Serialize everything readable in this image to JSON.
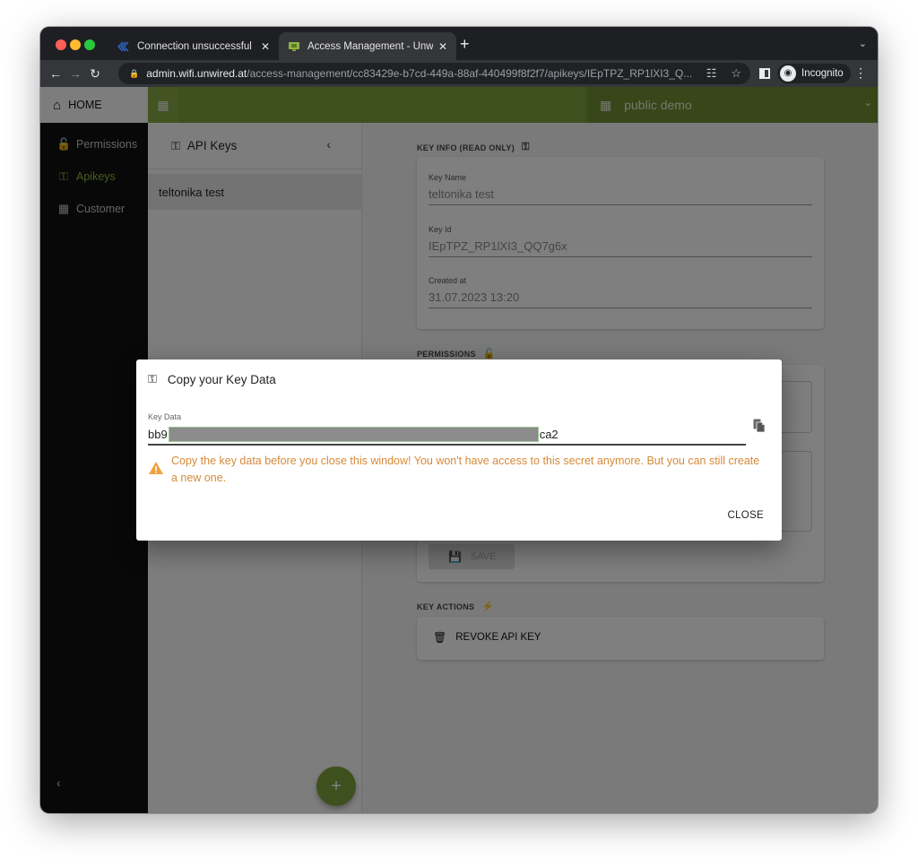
{
  "browser": {
    "tabs": [
      {
        "title": "Connection unsuccessful",
        "active": false,
        "favicon": "unwired-logo-icon"
      },
      {
        "title": "Access Management - Unwired",
        "active": true,
        "favicon": "monitor-icon"
      }
    ],
    "new_tab_label": "+",
    "address": {
      "host": "admin.wifi.unwired.at",
      "path": "/access-management/cc83429e-b7cd-449a-88af-440499f8f2f7/apikeys/IEpTPZ_RP1lXI3_Q..."
    },
    "profile_label": "Incognito"
  },
  "app": {
    "home_label": "HOME",
    "customer_selector": "public demo",
    "sidebar": {
      "items": [
        {
          "label": "Permissions",
          "icon": "lock-open-icon",
          "active": false
        },
        {
          "label": "Apikeys",
          "icon": "key-icon",
          "active": true
        },
        {
          "label": "Customer",
          "icon": "building-icon",
          "active": false
        }
      ]
    },
    "list": {
      "title": "API Keys",
      "items": [
        "teltonika test"
      ]
    },
    "detail": {
      "key_info_title": "KEY INFO (READ ONLY)",
      "fields": [
        {
          "label": "Key Name",
          "value": "teltonika test"
        },
        {
          "label": "Key Id",
          "value": "IEpTPZ_RP1lXI3_QQ7g6x"
        },
        {
          "label": "Created at",
          "value": "31.07.2023 13:20"
        }
      ],
      "permissions_title": "PERMISSIONS",
      "save_label": "SAVE",
      "key_actions_title": "KEY ACTIONS",
      "revoke_label": "REVOKE API KEY"
    }
  },
  "dialog": {
    "title": "Copy your Key Data",
    "field_label": "Key Data",
    "value_prefix": "bb9",
    "value_suffix": "ca2",
    "warning": "Copy the key data before you close this window! You won't have access to this secret anymore. But you can still create a new one.",
    "close_label": "CLOSE",
    "colors": {
      "warning": "#d58a3a",
      "accent": "#7da03c"
    }
  }
}
